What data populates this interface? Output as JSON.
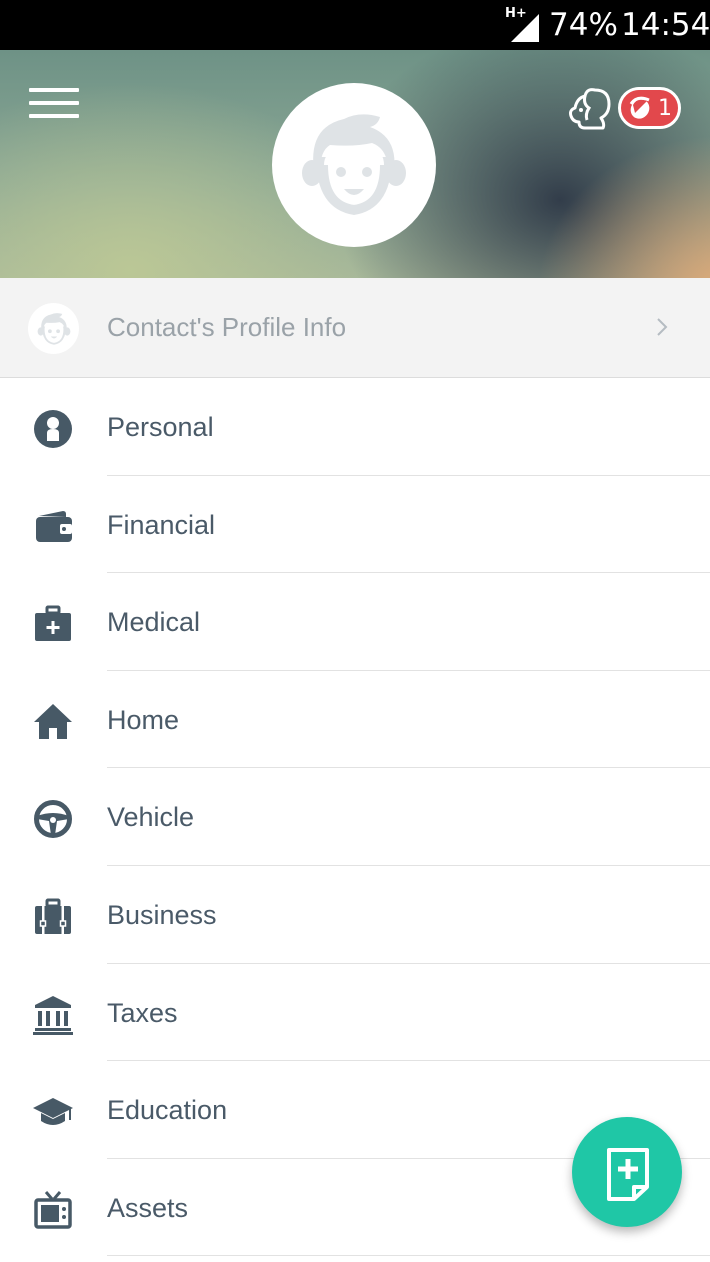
{
  "status_bar": {
    "network": "H+",
    "battery": "74%",
    "time": "14:54"
  },
  "header": {
    "notification_count": "1",
    "icons": [
      "menu-icon",
      "squirrel-icon",
      "acorn-icon",
      "user-face-icon"
    ]
  },
  "profile_row": {
    "label": "Contact's Profile Info"
  },
  "menu": {
    "items": [
      {
        "label": "Personal",
        "icon": "person-icon"
      },
      {
        "label": "Financial",
        "icon": "wallet-icon"
      },
      {
        "label": "Medical",
        "icon": "medical-kit-icon"
      },
      {
        "label": "Home",
        "icon": "house-icon"
      },
      {
        "label": "Vehicle",
        "icon": "steering-wheel-icon"
      },
      {
        "label": "Business",
        "icon": "briefcase-icon"
      },
      {
        "label": "Taxes",
        "icon": "bank-icon"
      },
      {
        "label": "Education",
        "icon": "graduation-cap-icon"
      },
      {
        "label": "Assets",
        "icon": "tv-icon"
      }
    ]
  },
  "fab": {
    "icon": "add-document-icon"
  },
  "colors": {
    "accent": "#1fc7a6",
    "badge": "#e2484c",
    "icon": "#475966",
    "text": "#4a5a68"
  }
}
